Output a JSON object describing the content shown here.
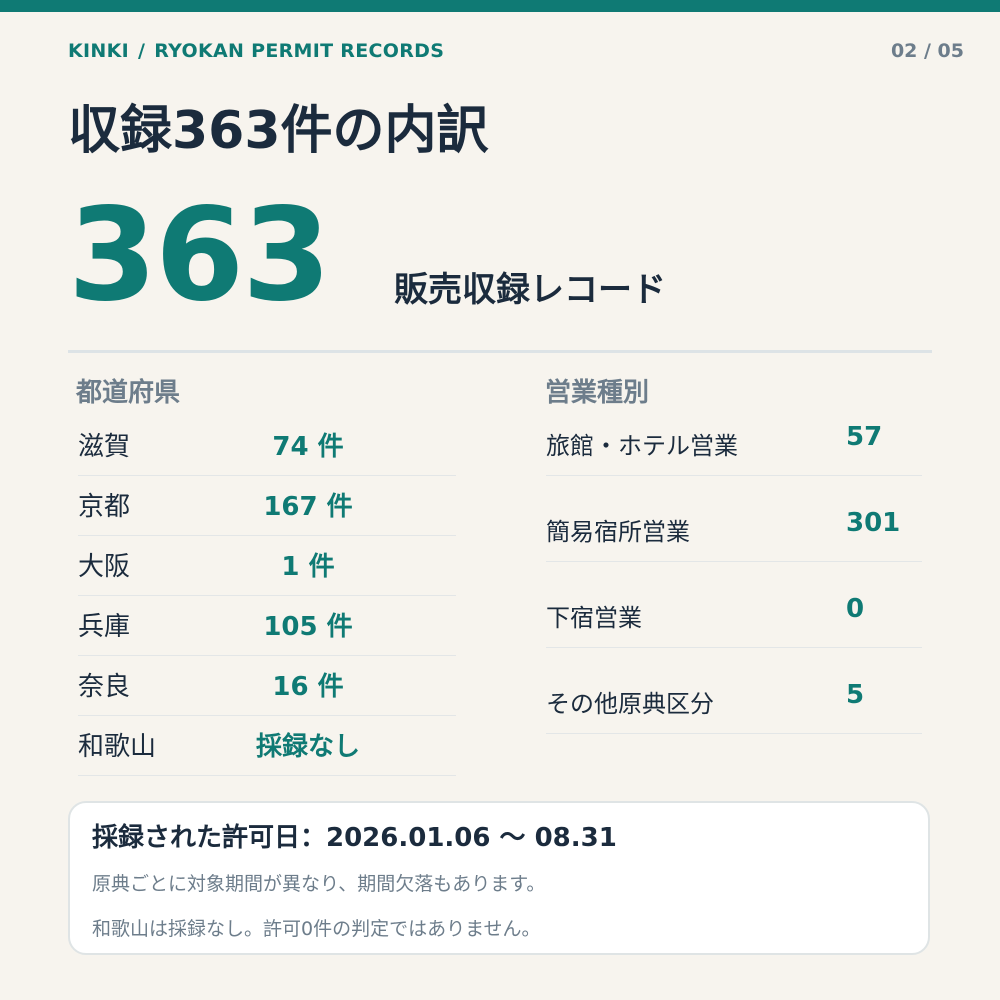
{
  "header": {
    "breadcrumb_region": "KINKI",
    "breadcrumb_separator": "/",
    "breadcrumb_section": "RYOKAN PERMIT RECORDS",
    "pager": "02 / 05",
    "accent_color": "#0f7a74"
  },
  "title": "収録363件の内訳",
  "summary": {
    "total": "363",
    "caption": "販売収録レコード"
  },
  "prefectures": {
    "heading": "都道府県",
    "rows": [
      {
        "name": "滋賀",
        "count": "74 件"
      },
      {
        "name": "京都",
        "count": "167 件"
      },
      {
        "name": "大阪",
        "count": "1 件"
      },
      {
        "name": "兵庫",
        "count": "105 件"
      },
      {
        "name": "奈良",
        "count": "16 件"
      },
      {
        "name": "和歌山",
        "count": "採録なし"
      }
    ]
  },
  "business_types": {
    "heading": "営業種別",
    "rows": [
      {
        "name": "旅館・ホテル営業",
        "count": "57"
      },
      {
        "name": "簡易宿所営業",
        "count": "301"
      },
      {
        "name": "下宿営業",
        "count": "0"
      },
      {
        "name": "その他原典区分",
        "count": "5"
      }
    ]
  },
  "note": {
    "title": "採録された許可日：2026.01.06 〜 08.31",
    "line1": "原典ごとに対象期間が異なり、期間欠落もあります。",
    "line2": "和歌山は採録なし。許可0件の判定ではありません。"
  }
}
